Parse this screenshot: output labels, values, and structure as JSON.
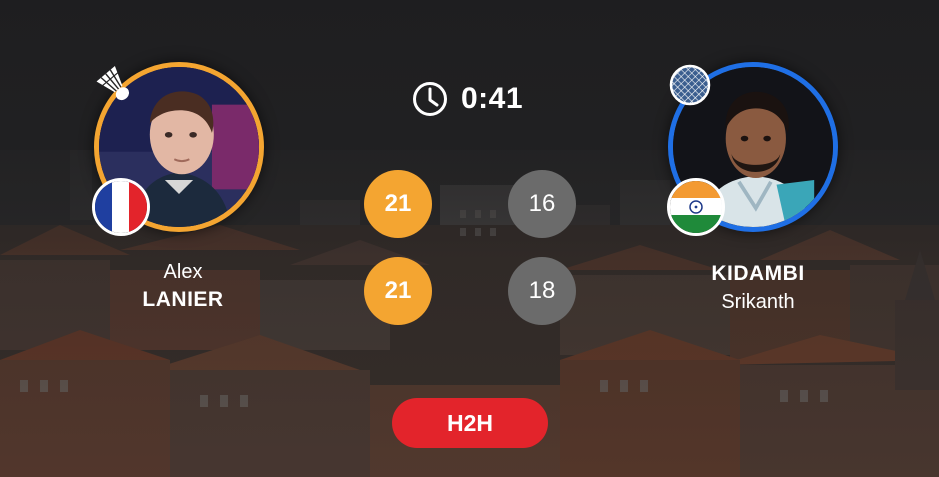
{
  "match": {
    "elapsed": "0:41",
    "h2h_label": "H2H"
  },
  "players": {
    "left": {
      "first_name": "Alex",
      "last_name": "LANIER",
      "country_flag": "france-flag",
      "serving": true,
      "ring_color": "#f4a531"
    },
    "right": {
      "first_name": "Srikanth",
      "last_name": "KIDAMBI",
      "country_flag": "india-flag",
      "serving": false,
      "ring_color": "#1f6fe5"
    }
  },
  "games": [
    {
      "left": "21",
      "right": "16",
      "winner": "left"
    },
    {
      "left": "21",
      "right": "18",
      "winner": "left"
    }
  ],
  "colors": {
    "winner_score": "#f4a531",
    "loser_score": "#6b6b6b",
    "h2h_button": "#e3242b"
  }
}
